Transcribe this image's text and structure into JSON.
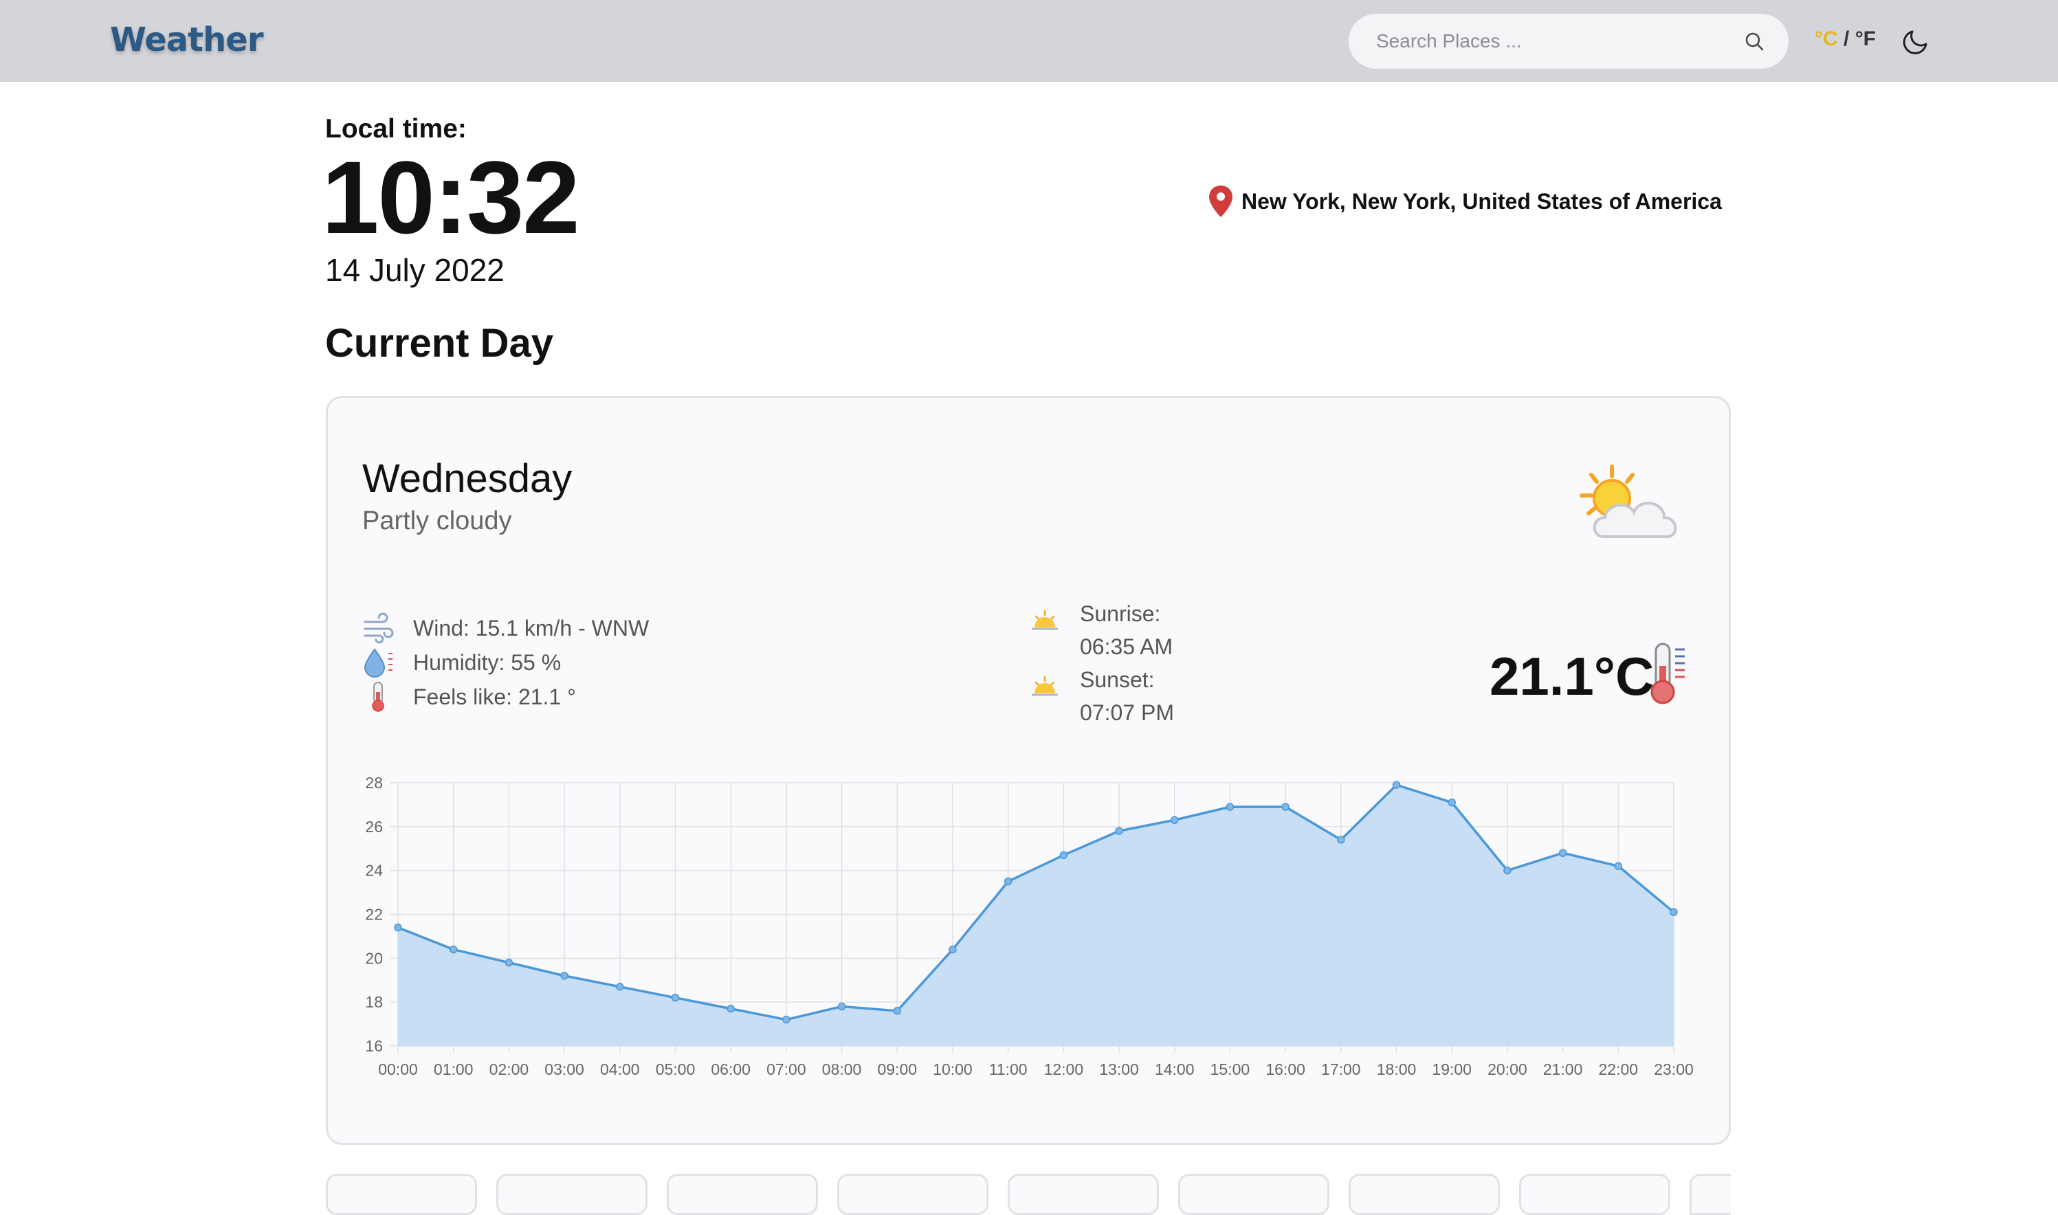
{
  "header": {
    "brand": "Weather",
    "search_placeholder": "Search Places ...",
    "unit_c": "°C",
    "unit_sep": " / ",
    "unit_f": "°F",
    "icons": {
      "search": "search-icon",
      "theme": "moon-icon"
    }
  },
  "local_time": {
    "label": "Local time:",
    "time": "10:32",
    "date": "14 July 2022"
  },
  "location": {
    "text": "New York, New York, United States of America",
    "icon": "map-pin-icon"
  },
  "section_title": "Current Day",
  "current": {
    "day": "Wednesday",
    "condition": "Partly cloudy",
    "wind": "Wind: 15.1 km/h - WNW",
    "humidity": "Humidity: 55 %",
    "feels_like": "Feels like: 21.1 °",
    "sunrise_label": "Sunrise:",
    "sunrise_time": "06:35 AM",
    "sunset_label": "Sunset:",
    "sunset_time": "07:07 PM",
    "temperature": "21.1°C"
  },
  "colors": {
    "accent_line": "#4b98d9",
    "area_fill": "#c5dcf3",
    "brand": "#2d5a85",
    "unit_active": "#e5b81c"
  },
  "chart_data": {
    "type": "area",
    "x": [
      "00:00",
      "01:00",
      "02:00",
      "03:00",
      "04:00",
      "05:00",
      "06:00",
      "07:00",
      "08:00",
      "09:00",
      "10:00",
      "11:00",
      "12:00",
      "13:00",
      "14:00",
      "15:00",
      "16:00",
      "17:00",
      "18:00",
      "19:00",
      "20:00",
      "21:00",
      "22:00",
      "23:00"
    ],
    "series": [
      {
        "values": [
          21.4,
          20.4,
          19.8,
          19.2,
          18.7,
          18.2,
          17.7,
          17.2,
          17.8,
          17.6,
          20.4,
          23.5,
          24.7,
          25.8,
          26.3,
          26.9,
          26.9,
          25.4,
          27.9,
          27.1,
          24.0,
          24.8,
          24.2,
          22.1
        ]
      }
    ],
    "yticks": [
      16,
      18,
      20,
      22,
      24,
      26,
      28
    ],
    "ylim": [
      16,
      28
    ],
    "grid": true
  }
}
